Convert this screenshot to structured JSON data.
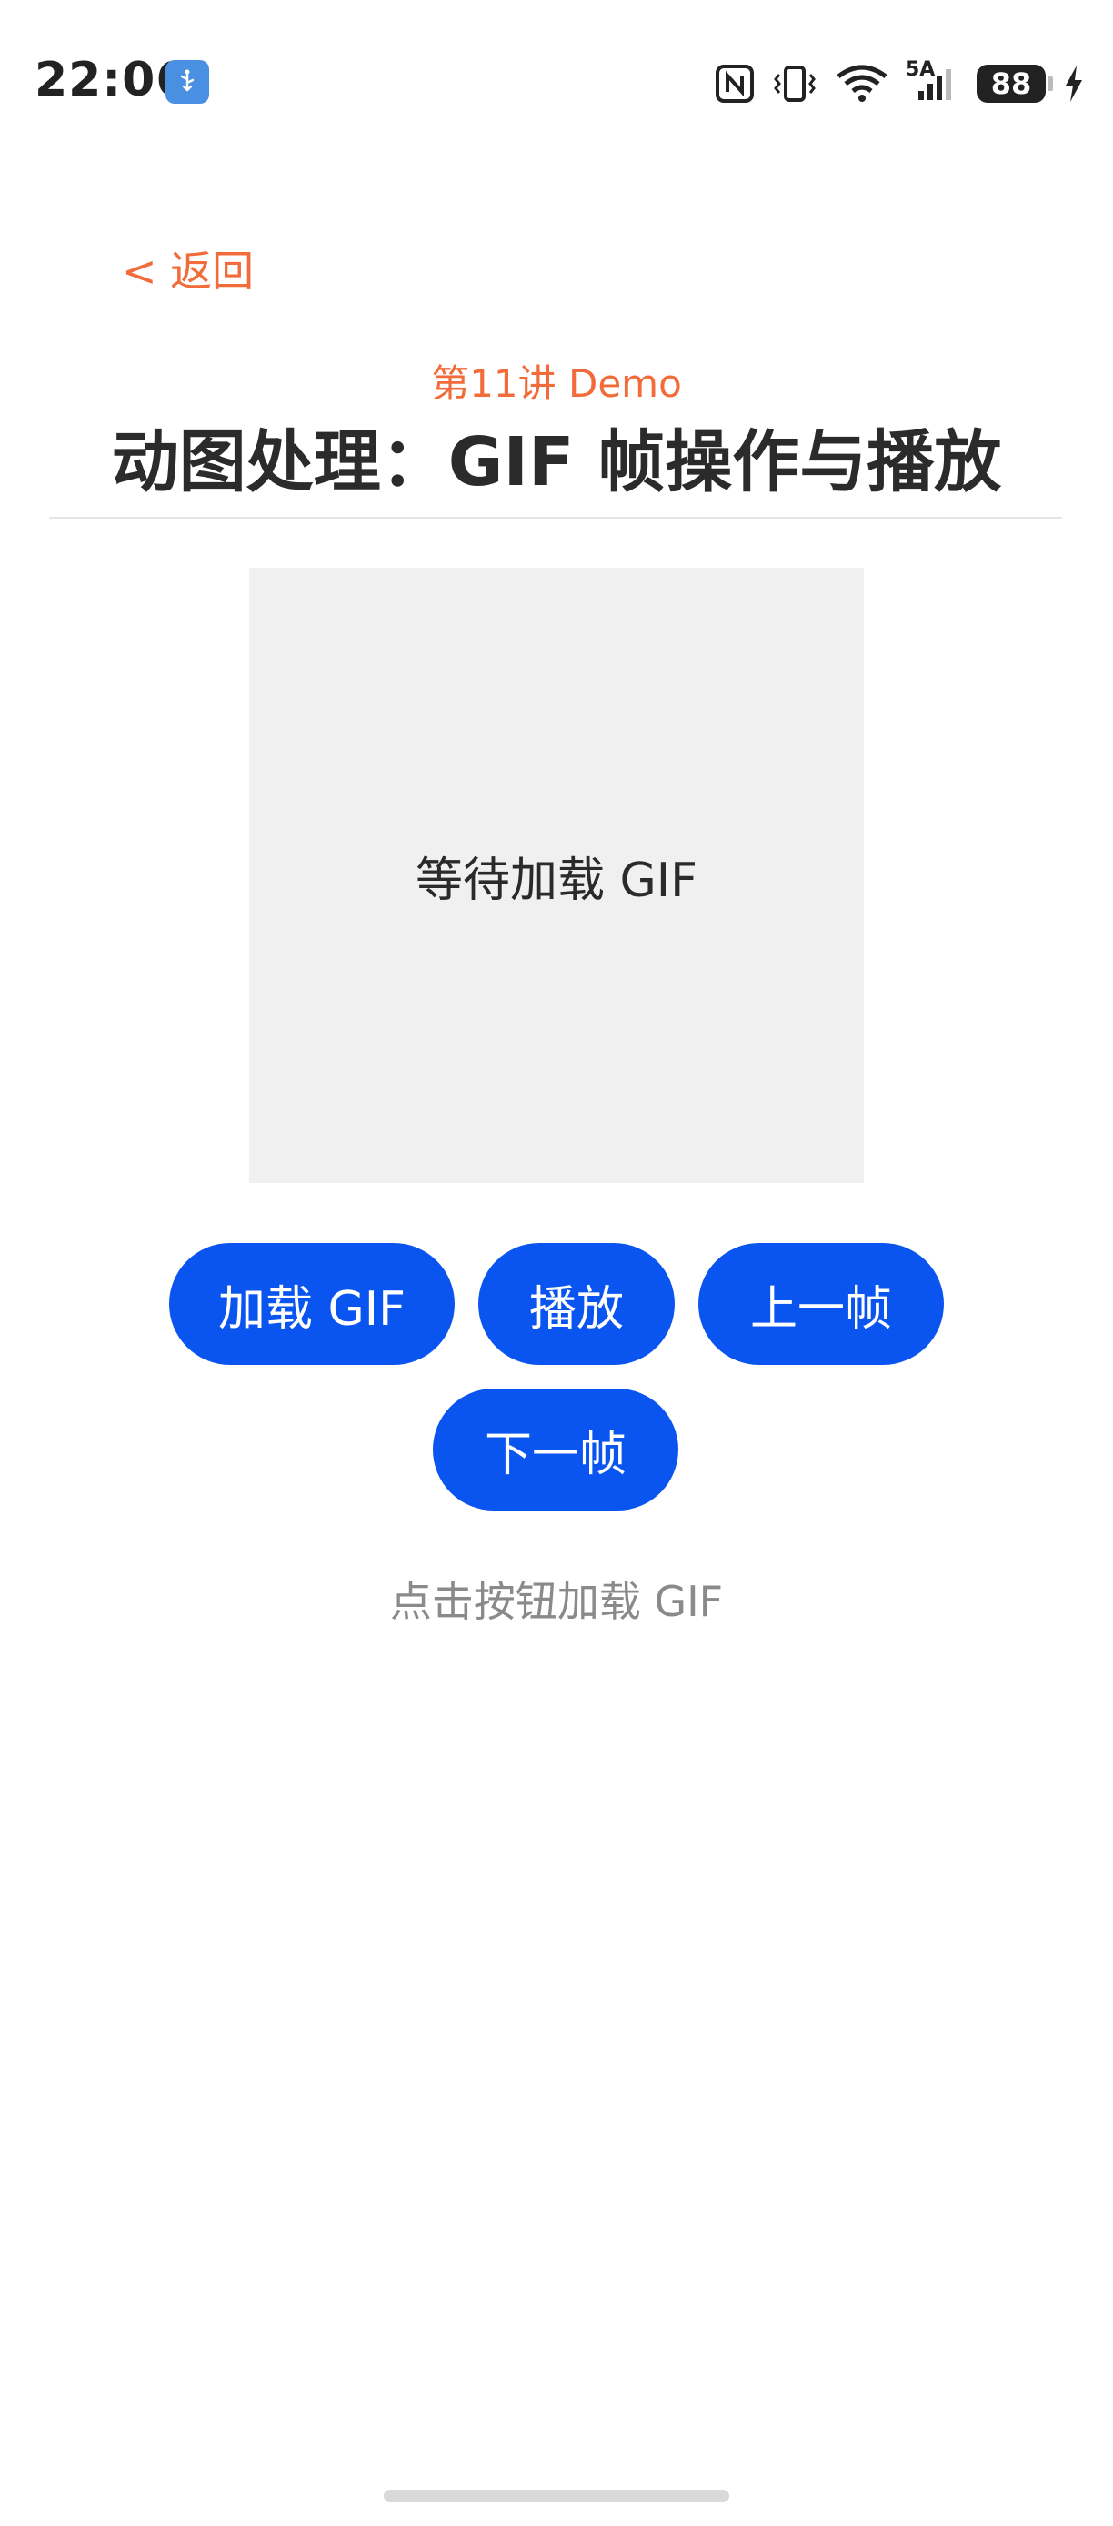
{
  "status_bar": {
    "time": "22:06",
    "network_label": "5A",
    "battery": "88",
    "icons": [
      "usb-icon",
      "nfc-icon",
      "vibrate-icon",
      "wifi-icon",
      "signal-icon",
      "battery-icon",
      "charging-icon"
    ],
    "accent_color": "#4a90e2"
  },
  "nav": {
    "back_label": "< 返回"
  },
  "header": {
    "subtitle": "第11讲 Demo",
    "title": "动图处理：GIF 帧操作与播放"
  },
  "preview": {
    "placeholder": "等待加载 GIF"
  },
  "controls": {
    "load_label": "加载 GIF",
    "play_label": "播放",
    "prev_label": "上一帧",
    "next_label": "下一帧"
  },
  "status": {
    "hint": "点击按钮加载 GIF"
  },
  "colors": {
    "accent_orange": "#f26b3a",
    "button_blue": "#0a55f0",
    "preview_bg": "#f0f0f0"
  }
}
